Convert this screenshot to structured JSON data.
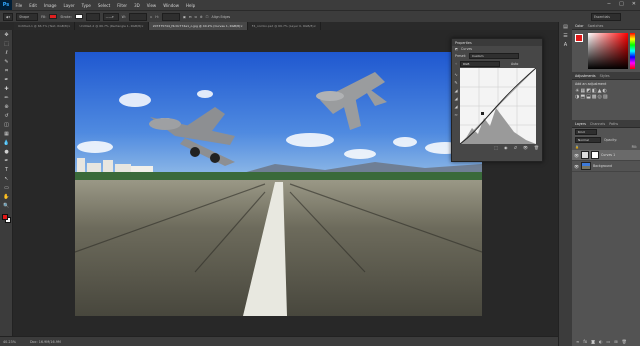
{
  "app": {
    "logo": "Ps"
  },
  "menu": [
    "File",
    "Edit",
    "Image",
    "Layer",
    "Type",
    "Select",
    "Filter",
    "3D",
    "View",
    "Window",
    "Help"
  ],
  "window_controls": [
    "−",
    "□",
    "✕"
  ],
  "options_bar": {
    "tool_mode": "Shape",
    "fill_label": "Fill:",
    "stroke_label": "Stroke:",
    "width_label": "W:",
    "height_label": "H:",
    "align_edges": "Align Edges",
    "workspace": "Essentials"
  },
  "tabs": [
    {
      "label": "Untitled-1 @ 66.7% (Text, RGB/8)",
      "active": false
    },
    {
      "label": "Untitled-2 @ 66.7% (Rectangle 1, RGB/8)",
      "active": false
    },
    {
      "label": "207375744_f4c0c774a1_o.jpg @ 40.2% (Curves 1, RGB/8)",
      "active": true
    },
    {
      "label": "F4_combo.psd @ 66.7% (Layer 0, RGB/8)",
      "active": false
    }
  ],
  "tools": [
    "move-icon",
    "marquee-icon",
    "lasso-icon",
    "quick-select-icon",
    "crop-icon",
    "eyedropper-icon",
    "healing-icon",
    "brush-icon",
    "stamp-icon",
    "history-brush-icon",
    "eraser-icon",
    "gradient-icon",
    "blur-icon",
    "dodge-icon",
    "pen-icon",
    "type-icon",
    "path-select-icon",
    "shape-icon",
    "hand-icon",
    "zoom-icon"
  ],
  "tool_glyphs": [
    "✥",
    "⬚",
    "ℓ",
    "✎",
    "⌗",
    "✒",
    "✚",
    "✏",
    "⊕",
    "↺",
    "◫",
    "▦",
    "💧",
    "●",
    "✒",
    "T",
    "↖",
    "▭",
    "✋",
    "🔍"
  ],
  "status": {
    "zoom": "40.23%",
    "doc": "Doc: 16.9M/16.9M"
  },
  "properties": {
    "title": "Properties",
    "adjustment": "Curves",
    "preset_label": "Preset:",
    "preset": "Custom",
    "channel": "RGB",
    "auto": "Auto"
  },
  "right_panels": {
    "color_tabs": [
      "Color",
      "Swatches"
    ],
    "adjust_tabs": [
      "Adjustments",
      "Styles"
    ],
    "adjust_hint": "Add an adjustment",
    "layer_tabs": [
      "Layers",
      "Channels",
      "Paths"
    ],
    "kind": "Kind",
    "blend": "Normal",
    "opacity_label": "Opacity:",
    "fill_label": "Fill:",
    "layers": [
      {
        "name": "Curves 1",
        "selected": true
      },
      {
        "name": "Background",
        "selected": false
      }
    ]
  },
  "colors": {
    "fg": "#e01818",
    "bg": "#ffffff"
  }
}
